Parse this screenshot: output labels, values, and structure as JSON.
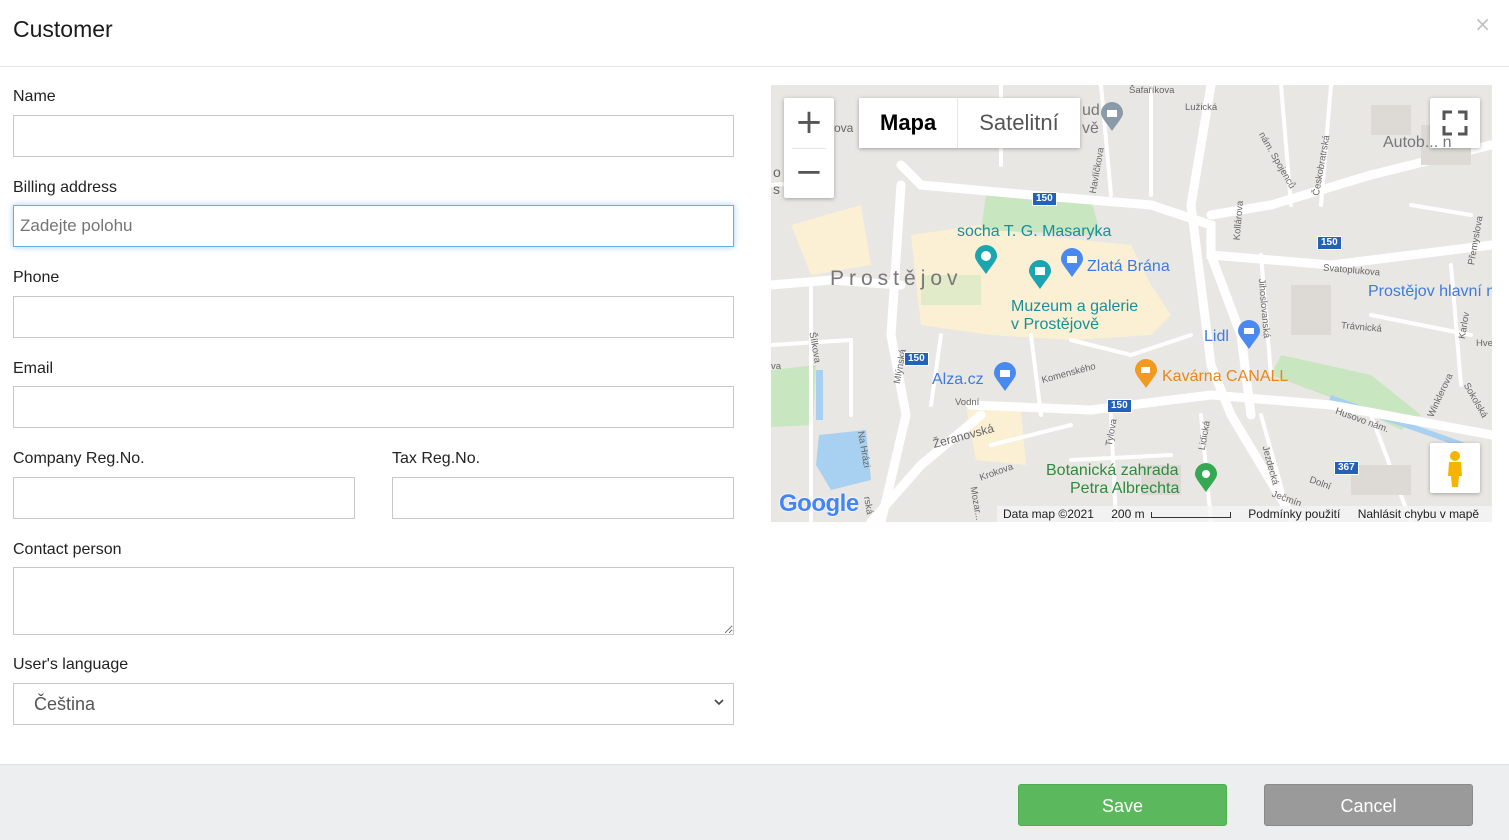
{
  "dialog": {
    "title": "Customer",
    "close_label": "×"
  },
  "form": {
    "name": {
      "label": "Name",
      "value": ""
    },
    "billing_address": {
      "label": "Billing address",
      "placeholder": "Zadejte polohu",
      "value": ""
    },
    "phone": {
      "label": "Phone",
      "value": ""
    },
    "email": {
      "label": "Email",
      "value": ""
    },
    "company_reg": {
      "label": "Company Reg.No.",
      "value": ""
    },
    "tax_reg": {
      "label": "Tax Reg.No.",
      "value": ""
    },
    "contact_person": {
      "label": "Contact person",
      "value": ""
    },
    "language": {
      "label": "User's language",
      "selected": "Čeština"
    }
  },
  "map": {
    "zoom_in": "+",
    "zoom_out": "−",
    "type_map": "Mapa",
    "type_satellite": "Satelitní",
    "city_label": "Prostějov",
    "pois": {
      "masaryk": "socha T. G. Masaryka",
      "zlata_brana": "Zlatá Brána",
      "muzeum_1": "Muzeum a galerie",
      "muzeum_2": "v Prostějově",
      "lidl": "Lidl",
      "alza": "Alza.cz",
      "kavarna": "Kavárna CANALL",
      "botanicka_1": "Botanická zahrada",
      "botanicka_2": "Petra Albrechta",
      "hlavni": "Prostějov hlavní n",
      "autobus": "Autob...  n",
      "lud_1": "ud",
      "lud_2": "vě"
    },
    "streets": {
      "mlynska": "Mlýnská",
      "komenskeho": "Komenského",
      "vodni": "Vodní",
      "zeranovska": "Žeranovská",
      "krokova": "Krokova",
      "tylova": "Tylova",
      "lidicka": "Lidická",
      "jezdecka": "Jezdecká",
      "svatoplukova": "Svatoplukova",
      "travnicka": "Trávnická",
      "husovo": "Husovo nám.",
      "jihoslovanska": "Jihoslovanská",
      "havlickova": "Havlíčkova",
      "ceskobratrska": "Českobratrská",
      "kollarova": "Kollárova",
      "na_hrazi": "Na Hrázi",
      "silkova": "Šílkova",
      "luzicka": "Lužická",
      "safarikova": "Šafaříkova",
      "premyslova": "Přemyslova",
      "karlov": "Karlov",
      "winklerova": "Winklerova",
      "sokolska": "Sokolská",
      "dolni": "Dolní",
      "jecminkova": "Ječmín...",
      "mozartova": "Mozar...",
      "nam_spojencu": "nám. Spojenců",
      "ova_left": "ova",
      "va_left": "va",
      "o_left": "o",
      "s_left": "s",
      "ska": "rská",
      "hve": "Hve"
    },
    "routes": {
      "r150a": "150",
      "r150b": "150",
      "r150c": "150",
      "r150d": "150",
      "r367": "367"
    },
    "attribution": {
      "data": "Data map ©2021",
      "scale": "200 m",
      "terms": "Podmínky použití",
      "report": "Nahlásit chybu v mapě"
    },
    "logo": "Google"
  },
  "footer": {
    "save_label": "Save",
    "cancel_label": "Cancel"
  },
  "colors": {
    "save": "#5cb85c",
    "cancel": "#9a9a9a",
    "poi_teal": "#1a8f9a",
    "poi_blue": "#3d7be0",
    "poi_orange": "#e8861a",
    "poi_green": "#2e8b3e"
  }
}
